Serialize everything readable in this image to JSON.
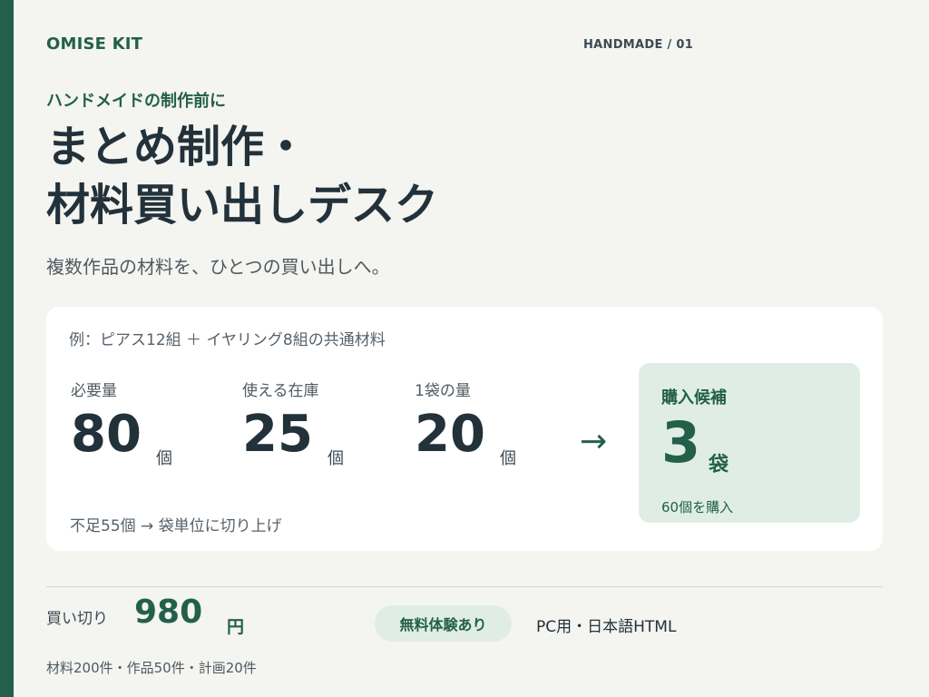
{
  "brand": "OMISE KIT",
  "series": "HANDMADE / 01",
  "hero": {
    "eyebrow": "ハンドメイドの制作前に",
    "title_line1": "まとめ制作・",
    "title_line2": "材料買い出しデスク",
    "subtitle": "複数作品の材料を、ひとつの買い出しへ。"
  },
  "example_card": {
    "example": "例：ピアス12組 ＋ イヤリング8組の共通材料",
    "metrics": [
      {
        "label": "必要量",
        "value": "80",
        "unit": "個"
      },
      {
        "label": "使える在庫",
        "value": "25",
        "unit": "個"
      },
      {
        "label": "1袋の量",
        "value": "20",
        "unit": "個"
      }
    ],
    "arrow": "→",
    "result": {
      "label": "購入候補",
      "value": "3",
      "unit": "袋",
      "note": "60個を購入"
    },
    "shortage_note": "不足55個 → 袋単位に切り上げ"
  },
  "pricing": {
    "label": "買い切り",
    "value": "980",
    "unit": "円",
    "trial_badge": "無料体験あり",
    "platform": "PC用・日本語HTML",
    "limits": "材料200件・作品50件・計画20件"
  },
  "colors": {
    "accent": "#23604c",
    "accent_light": "#e0ede5",
    "background": "#f4f4f1",
    "text": "#22313a"
  }
}
